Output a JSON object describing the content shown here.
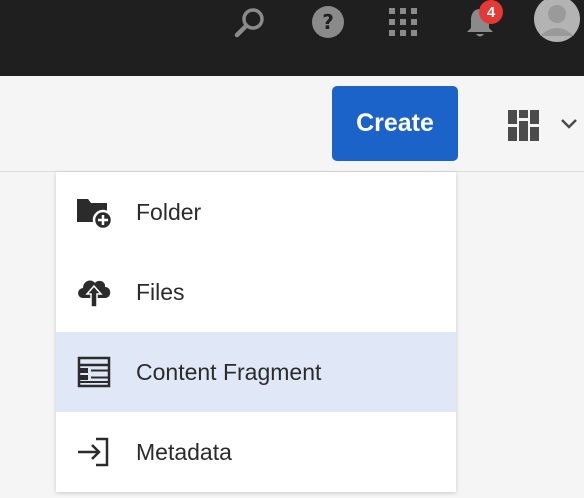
{
  "topbar": {
    "search_icon": "search-icon",
    "help_icon": "help-icon",
    "solutions_icon": "grid-icon",
    "notifications_icon": "bell-icon",
    "notification_count": "4",
    "avatar_icon": "user-avatar-icon"
  },
  "toolbar": {
    "create_label": "Create",
    "view_switch_icon": "view-switch-icon",
    "view_chevron_icon": "chevron-down-icon"
  },
  "create_menu": {
    "items": [
      {
        "label": "Folder",
        "icon": "folder-add-icon",
        "highlighted": false
      },
      {
        "label": "Files",
        "icon": "cloud-upload-icon",
        "highlighted": false
      },
      {
        "label": "Content Fragment",
        "icon": "content-fragment-icon",
        "highlighted": true
      },
      {
        "label": "Metadata",
        "icon": "import-icon",
        "highlighted": false
      }
    ]
  },
  "colors": {
    "topbar_bg": "#1f1f1f",
    "accent": "#1c63c9",
    "badge": "#e53935",
    "highlight": "#e0e8f8"
  }
}
